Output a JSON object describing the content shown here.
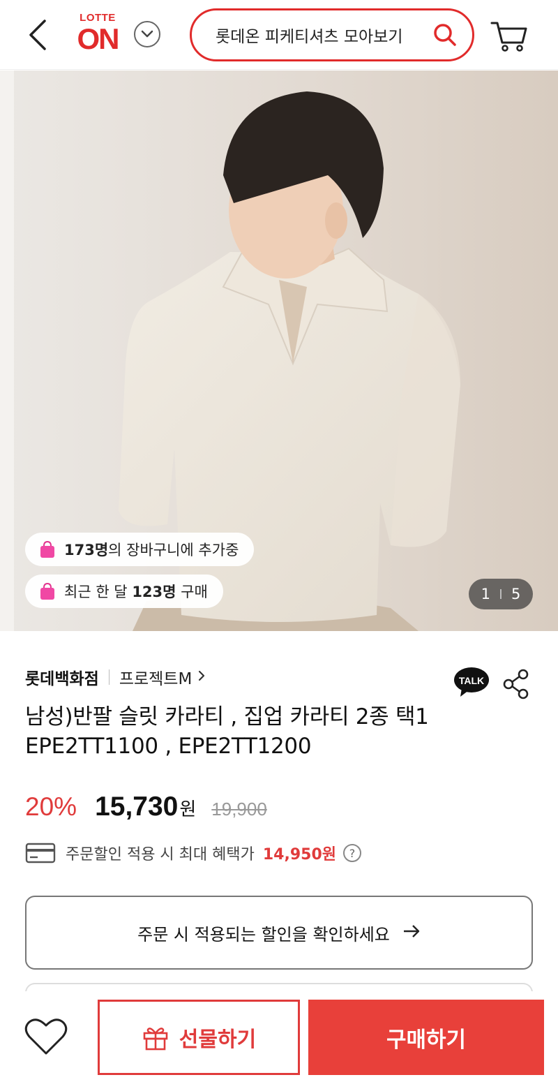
{
  "header": {
    "logo_top": "LOTTE",
    "logo_main": "ON",
    "search_text": "롯데온 피케티셔츠 모아보기"
  },
  "hero": {
    "badge_cart": {
      "count": "173명",
      "suffix": "의 장바구니에 추가중"
    },
    "badge_buy": {
      "prefix": "최근 한 달 ",
      "count": "123명",
      "suffix": " 구매"
    },
    "counter": {
      "current": "1",
      "total": "5"
    }
  },
  "product": {
    "brand": "롯데백화점",
    "sub_brand": "프로젝트M",
    "title": "남성)반팔 슬릿 카라티 , 집업 카라티 2종 택1 EPE2TT1100 , EPE2TT1200",
    "discount": "20%",
    "price": "15,730",
    "won": "원",
    "original_price": "19,900",
    "benefit_label": "주문할인 적용 시 최대 혜택가",
    "benefit_price": "14,950원",
    "check_discount": "주문 시 적용되는 할인을 확인하세요"
  },
  "talk_label": "TALK",
  "bottom_bar": {
    "gift": "선물하기",
    "buy": "구매하기"
  },
  "colors": {
    "brand_red": "#e12b2b",
    "buy_red": "#e8403a"
  }
}
